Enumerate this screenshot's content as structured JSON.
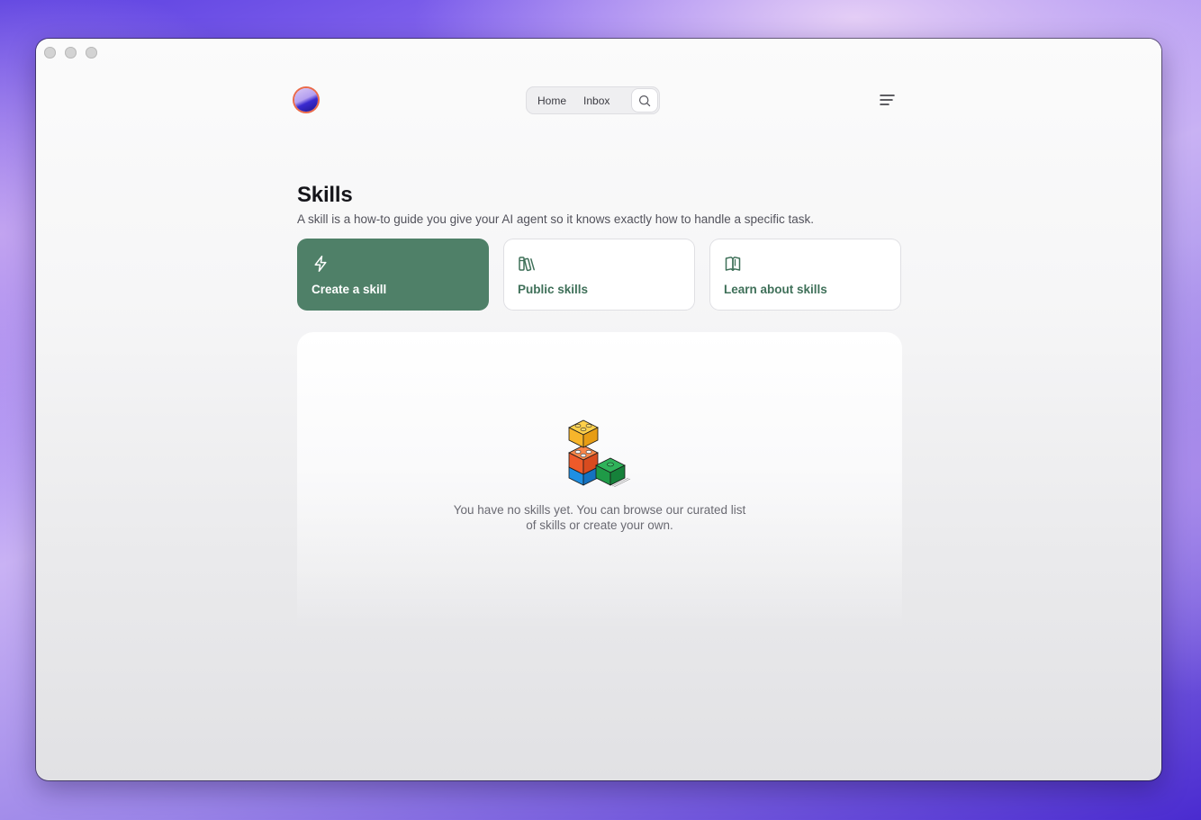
{
  "nav": {
    "home": "Home",
    "inbox": "Inbox"
  },
  "page": {
    "title": "Skills",
    "subtitle": "A skill is a how-to guide you give your AI agent so it knows exactly how to handle a specific task."
  },
  "cards": [
    {
      "label": "Create a skill",
      "icon": "lightning-icon"
    },
    {
      "label": "Public skills",
      "icon": "books-icon"
    },
    {
      "label": "Learn about skills",
      "icon": "open-book-icon"
    }
  ],
  "empty_state": {
    "text": "You have no skills yet. You can browse our curated list of skills or create your own.",
    "illustration": "blocks-illustration"
  },
  "colors": {
    "accent_green": "#4f8068",
    "accent_text": "#3f7059",
    "logo_ring": "#ea6a4a"
  }
}
